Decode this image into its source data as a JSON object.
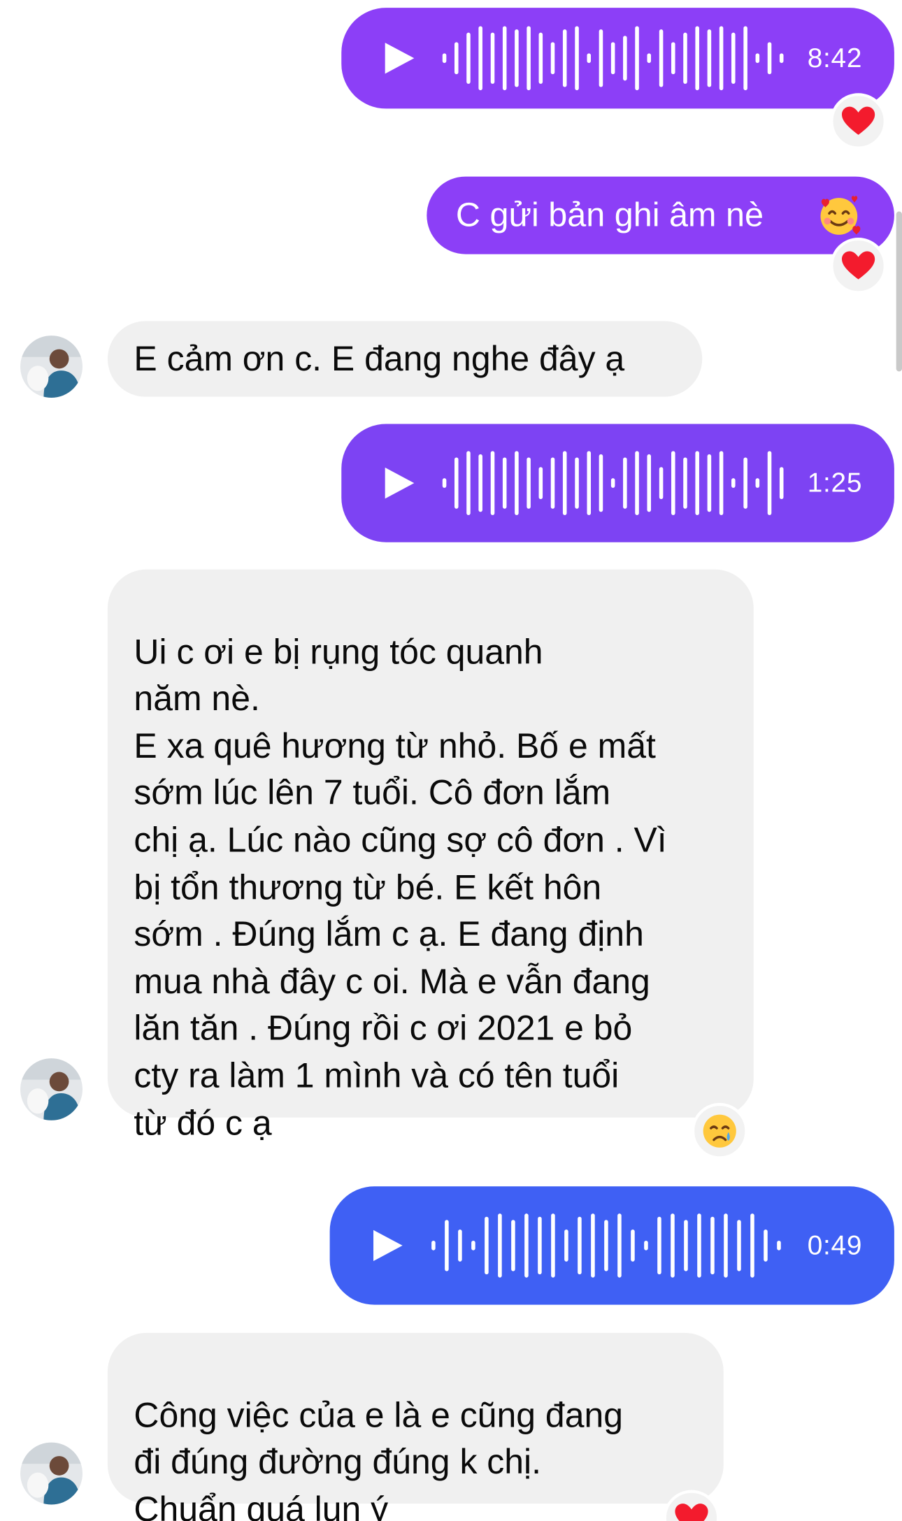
{
  "colors": {
    "sent_purple": "#8c3ff7",
    "sent_violet": "#7d43f3",
    "sent_blue": "#3f60f4",
    "received_bg": "#f0f0f0",
    "heart_red": "#f31b2d"
  },
  "messages": [
    {
      "id": "m1",
      "side": "sent",
      "kind": "voice",
      "duration": "8:42",
      "reaction": "heart-icon"
    },
    {
      "id": "m2",
      "side": "sent",
      "kind": "text",
      "text": "C gửi bản ghi âm nè",
      "emoji": "smiling-face-with-hearts-icon",
      "reaction": "heart-icon"
    },
    {
      "id": "m3",
      "side": "received",
      "kind": "text",
      "text": "E cảm ơn c. E đang nghe đây ạ"
    },
    {
      "id": "m4",
      "side": "sent",
      "kind": "voice",
      "duration": "1:25"
    },
    {
      "id": "m5",
      "side": "received",
      "kind": "text",
      "text": "Ui c ơi e bị rụng tóc quanh\nnăm nè.\nE xa quê hương từ nhỏ. Bố e mất\nsớm lúc lên 7 tuổi. Cô đơn lắm\nchị ạ. Lúc nào cũng sợ cô đơn . Vì\nbị tổn thương từ bé. E kết hôn\nsớm . Đúng lắm c ạ. E đang định\nmua nhà đây c oi. Mà e vẫn đang\nlăn tăn . Đúng rồi c ơi 2021 e bỏ\ncty ra làm 1 mình và có tên tuổi\ntừ đó c ạ",
      "reaction": "crying-face-icon"
    },
    {
      "id": "m6",
      "side": "sent",
      "kind": "voice",
      "duration": "0:49"
    },
    {
      "id": "m7",
      "side": "received",
      "kind": "text",
      "text": "Công việc của e là e cũng đang\nđi đúng đường đúng k chị.\nChuẩn quá lun ý",
      "reaction": "heart-icon"
    }
  ]
}
